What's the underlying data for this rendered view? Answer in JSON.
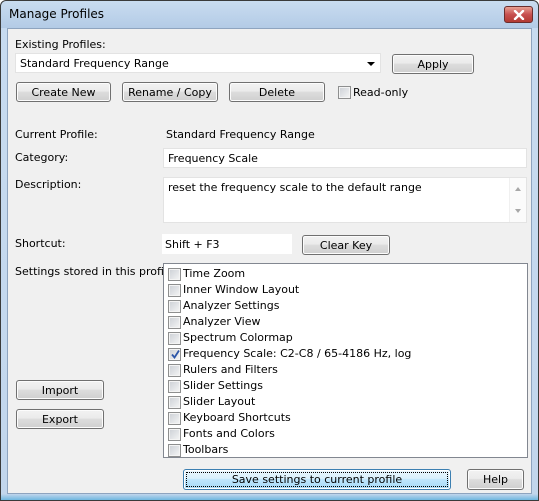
{
  "window": {
    "title": "Manage Profiles",
    "close_icon": "close-icon"
  },
  "existing_profiles": {
    "label": "Existing Profiles:",
    "selected": "Standard Frequency Range",
    "apply_label": "Apply"
  },
  "actions": {
    "create_new": "Create New",
    "rename_copy": "Rename / Copy",
    "delete": "Delete",
    "read_only_label": "Read-only",
    "read_only_checked": false
  },
  "current_profile": {
    "label": "Current Profile:",
    "value": "Standard Frequency Range"
  },
  "category": {
    "label": "Category:",
    "value": "Frequency Scale"
  },
  "description": {
    "label": "Description:",
    "value": "reset the frequency scale to the default range"
  },
  "shortcut": {
    "label": "Shortcut:",
    "value": "Shift + F3",
    "clear_label": "Clear Key"
  },
  "settings": {
    "label": "Settings stored in this profile:",
    "items": [
      {
        "label": "Time Zoom",
        "checked": false
      },
      {
        "label": "Inner Window Layout",
        "checked": false
      },
      {
        "label": "Analyzer Settings",
        "checked": false
      },
      {
        "label": "Analyzer View",
        "checked": false
      },
      {
        "label": "Spectrum Colormap",
        "checked": false
      },
      {
        "label": "Frequency Scale: C2-C8 / 65-4186 Hz, log",
        "checked": true
      },
      {
        "label": "Rulers and Filters",
        "checked": false
      },
      {
        "label": "Slider Settings",
        "checked": false
      },
      {
        "label": "Slider Layout",
        "checked": false
      },
      {
        "label": "Keyboard Shortcuts",
        "checked": false
      },
      {
        "label": "Fonts and Colors",
        "checked": false
      },
      {
        "label": "Toolbars",
        "checked": false
      }
    ]
  },
  "side_buttons": {
    "import": "Import",
    "export": "Export"
  },
  "footer": {
    "save_label": "Save settings to current profile",
    "help_label": "Help"
  }
}
